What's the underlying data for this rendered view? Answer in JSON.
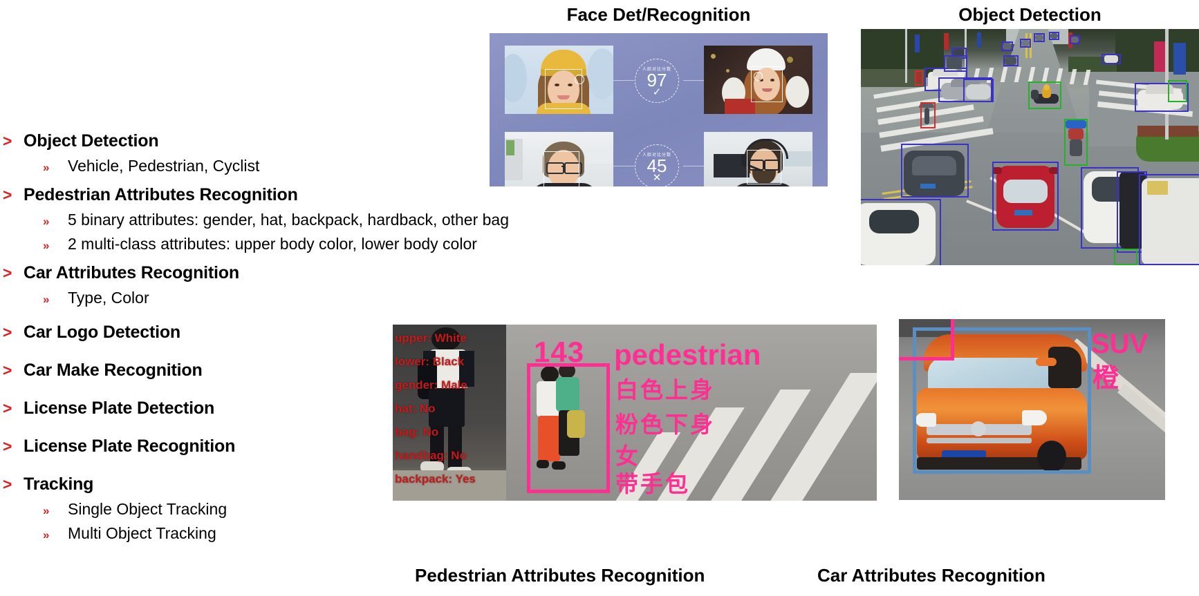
{
  "panels": {
    "face": {
      "title": "Face Det/Recognition",
      "pairs": [
        {
          "score": "97",
          "label_cn": "人脸对比分数",
          "result": "✓",
          "result_name": "match"
        },
        {
          "score": "45",
          "label_cn": "人脸对比分数",
          "result": "✕",
          "result_name": "no-match"
        }
      ]
    },
    "object_detection": {
      "title": "Object Detection",
      "box_colors": {
        "vehicle": "#3a32c8",
        "cyclist": "#23b423",
        "pedestrian": "#d42b2b"
      }
    },
    "pedestrian_attributes": {
      "caption": "Pedestrian Attributes Recognition",
      "overlay_left": [
        "upper: White",
        "lower: Black",
        "gender: Male",
        "hat: No",
        "bag: No",
        "handbag: No",
        "backpack: Yes"
      ],
      "overlay_right": {
        "track_id": "143",
        "class_label": "pedestrian",
        "attributes_cn": [
          "白色上身",
          "粉色下身",
          "女",
          "带手包"
        ]
      },
      "accent_color": "#ff2e92",
      "text_color": "#c41a1a"
    },
    "car_attributes": {
      "caption": "Car Attributes Recognition",
      "overlay": [
        "SUV",
        "橙"
      ],
      "accent_color": "#ff2e92",
      "box_color": "#5b8fc2"
    }
  },
  "bullets": {
    "marker_l1": ">",
    "marker_l2": "»",
    "marker_color": "#e02020",
    "groups": [
      {
        "title": "Object Detection",
        "subs": [
          "Vehicle, Pedestrian, Cyclist"
        ]
      },
      {
        "title": "Pedestrian Attributes Recognition",
        "subs": [
          "5 binary attributes: gender, hat, backpack, hardback, other bag",
          "2 multi-class attributes: upper body color, lower body color"
        ]
      },
      {
        "title": "Car Attributes Recognition",
        "subs": [
          "Type, Color"
        ]
      },
      {
        "title": "Car Logo Detection",
        "subs": []
      },
      {
        "title": "Car Make Recognition",
        "subs": []
      },
      {
        "title": "License Plate Detection",
        "subs": []
      },
      {
        "title": "License Plate Recognition",
        "subs": []
      },
      {
        "title": "Tracking",
        "subs": [
          "Single Object Tracking",
          "Multi Object Tracking"
        ]
      }
    ]
  }
}
